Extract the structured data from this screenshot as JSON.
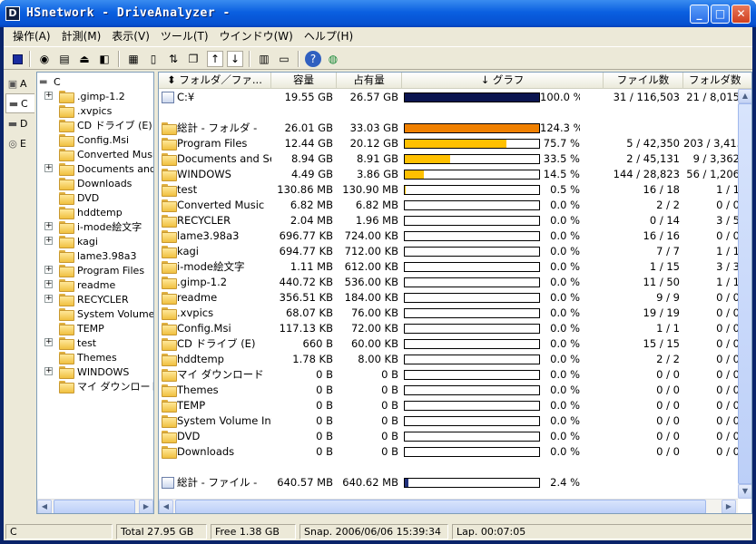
{
  "window": {
    "title": "HSnetwork - DriveAnalyzer -",
    "icon_letter": "D"
  },
  "menu": [
    "操作(A)",
    "計測(M)",
    "表示(V)",
    "ツール(T)",
    "ウインドウ(W)",
    "ヘルプ(H)"
  ],
  "drives": [
    {
      "letter": "A"
    },
    {
      "letter": "C"
    },
    {
      "letter": "D"
    },
    {
      "letter": "E"
    }
  ],
  "tree": {
    "root": "C",
    "items": [
      {
        "label": ".gimp-1.2",
        "expandable": true
      },
      {
        "label": ".xvpics",
        "expandable": false
      },
      {
        "label": "CD ドライブ (E)",
        "expandable": false
      },
      {
        "label": "Config.Msi",
        "expandable": false
      },
      {
        "label": "Converted Music",
        "expandable": false
      },
      {
        "label": "Documents and S",
        "expandable": true
      },
      {
        "label": "Downloads",
        "expandable": false
      },
      {
        "label": "DVD",
        "expandable": false
      },
      {
        "label": "hddtemp",
        "expandable": false
      },
      {
        "label": "i-mode絵文字",
        "expandable": true
      },
      {
        "label": "kagi",
        "expandable": true
      },
      {
        "label": "lame3.98a3",
        "expandable": false
      },
      {
        "label": "Program Files",
        "expandable": true
      },
      {
        "label": "readme",
        "expandable": true
      },
      {
        "label": "RECYCLER",
        "expandable": true
      },
      {
        "label": "System Volume I",
        "expandable": false
      },
      {
        "label": "TEMP",
        "expandable": false
      },
      {
        "label": "test",
        "expandable": true
      },
      {
        "label": "Themes",
        "expandable": false
      },
      {
        "label": "WINDOWS",
        "expandable": true
      },
      {
        "label": "マイ ダウンロード",
        "expandable": false
      }
    ]
  },
  "columns": {
    "folder": "フォルダ／ファ...",
    "capacity": "容量",
    "occupied": "占有量",
    "graph": "グラフ",
    "files": "ファイル数",
    "folders": "フォルダ数"
  },
  "rows": [
    {
      "name": "C:¥",
      "cap": "19.55 GB",
      "occ": "26.57 GB",
      "pct": 100.0,
      "pct_text": "100.0 %",
      "files": "31 / 116,503",
      "folders": "21 / 8,015",
      "kind": "drive"
    },
    {
      "spacer": true
    },
    {
      "name": "総計 - フォルダ -",
      "cap": "26.01 GB",
      "occ": "33.03 GB",
      "pct": 124.3,
      "pct_text": "124.3 %",
      "files": "",
      "folders": "",
      "kind": "total"
    },
    {
      "name": "Program Files",
      "cap": "12.44 GB",
      "occ": "20.12 GB",
      "pct": 75.7,
      "pct_text": "75.7 %",
      "files": "5 / 42,350",
      "folders": "203 / 3,415"
    },
    {
      "name": "Documents and Set...",
      "cap": "8.94 GB",
      "occ": "8.91 GB",
      "pct": 33.5,
      "pct_text": "33.5 %",
      "files": "2 / 45,131",
      "folders": "9 / 3,362"
    },
    {
      "name": "WINDOWS",
      "cap": "4.49 GB",
      "occ": "3.86 GB",
      "pct": 14.5,
      "pct_text": "14.5 %",
      "files": "144 / 28,823",
      "folders": "56 / 1,206"
    },
    {
      "name": "test",
      "cap": "130.86 MB",
      "occ": "130.90 MB",
      "pct": 0.5,
      "pct_text": "0.5 %",
      "files": "16 / 18",
      "folders": "1 / 1"
    },
    {
      "name": "Converted Music",
      "cap": "6.82 MB",
      "occ": "6.82 MB",
      "pct": 0.0,
      "pct_text": "0.0 %",
      "files": "2 / 2",
      "folders": "0 / 0"
    },
    {
      "name": "RECYCLER",
      "cap": "2.04 MB",
      "occ": "1.96 MB",
      "pct": 0.0,
      "pct_text": "0.0 %",
      "files": "0 / 14",
      "folders": "3 / 5"
    },
    {
      "name": "lame3.98a3",
      "cap": "696.77 KB",
      "occ": "724.00 KB",
      "pct": 0.0,
      "pct_text": "0.0 %",
      "files": "16 / 16",
      "folders": "0 / 0"
    },
    {
      "name": "kagi",
      "cap": "694.77 KB",
      "occ": "712.00 KB",
      "pct": 0.0,
      "pct_text": "0.0 %",
      "files": "7 / 7",
      "folders": "1 / 1"
    },
    {
      "name": "i-mode絵文字",
      "cap": "1.11 MB",
      "occ": "612.00 KB",
      "pct": 0.0,
      "pct_text": "0.0 %",
      "files": "1 / 15",
      "folders": "3 / 3"
    },
    {
      "name": ".gimp-1.2",
      "cap": "440.72 KB",
      "occ": "536.00 KB",
      "pct": 0.0,
      "pct_text": "0.0 %",
      "files": "11 / 50",
      "folders": "1 / 1"
    },
    {
      "name": "readme",
      "cap": "356.51 KB",
      "occ": "184.00 KB",
      "pct": 0.0,
      "pct_text": "0.0 %",
      "files": "9 / 9",
      "folders": "0 / 0"
    },
    {
      "name": ".xvpics",
      "cap": "68.07 KB",
      "occ": "76.00 KB",
      "pct": 0.0,
      "pct_text": "0.0 %",
      "files": "19 / 19",
      "folders": "0 / 0"
    },
    {
      "name": "Config.Msi",
      "cap": "117.13 KB",
      "occ": "72.00 KB",
      "pct": 0.0,
      "pct_text": "0.0 %",
      "files": "1 / 1",
      "folders": "0 / 0"
    },
    {
      "name": "CD ドライブ (E)",
      "cap": "660 B",
      "occ": "60.00 KB",
      "pct": 0.0,
      "pct_text": "0.0 %",
      "files": "15 / 15",
      "folders": "0 / 0"
    },
    {
      "name": "hddtemp",
      "cap": "1.78 KB",
      "occ": "8.00 KB",
      "pct": 0.0,
      "pct_text": "0.0 %",
      "files": "2 / 2",
      "folders": "0 / 0"
    },
    {
      "name": "マイ ダウンロード",
      "cap": "0 B",
      "occ": "0 B",
      "pct": 0.0,
      "pct_text": "0.0 %",
      "files": "0 / 0",
      "folders": "0 / 0"
    },
    {
      "name": "Themes",
      "cap": "0 B",
      "occ": "0 B",
      "pct": 0.0,
      "pct_text": "0.0 %",
      "files": "0 / 0",
      "folders": "0 / 0"
    },
    {
      "name": "TEMP",
      "cap": "0 B",
      "occ": "0 B",
      "pct": 0.0,
      "pct_text": "0.0 %",
      "files": "0 / 0",
      "folders": "0 / 0"
    },
    {
      "name": "System Volume Inf...",
      "cap": "0 B",
      "occ": "0 B",
      "pct": 0.0,
      "pct_text": "0.0 %",
      "files": "0 / 0",
      "folders": "0 / 0"
    },
    {
      "name": "DVD",
      "cap": "0 B",
      "occ": "0 B",
      "pct": 0.0,
      "pct_text": "0.0 %",
      "files": "0 / 0",
      "folders": "0 / 0"
    },
    {
      "name": "Downloads",
      "cap": "0 B",
      "occ": "0 B",
      "pct": 0.0,
      "pct_text": "0.0 %",
      "files": "0 / 0",
      "folders": "0 / 0"
    },
    {
      "spacer": true
    },
    {
      "name": "総計 - ファイル -",
      "cap": "640.57 MB",
      "occ": "640.62 MB",
      "pct": 2.4,
      "pct_text": "2.4 %",
      "files": "",
      "folders": "",
      "kind": "files-total"
    }
  ],
  "colors": {
    "drive_bar": "#0a1450",
    "total_bar": "#f08000",
    "folder_bar": "#ffc000",
    "files_bar": "#20307a"
  },
  "status": {
    "drive": "C",
    "total": "Total  27.95 GB",
    "free": "Free  1.38 GB",
    "snap": "Snap.  2006/06/06 15:39:34",
    "lap": "Lap.  00:07:05"
  }
}
